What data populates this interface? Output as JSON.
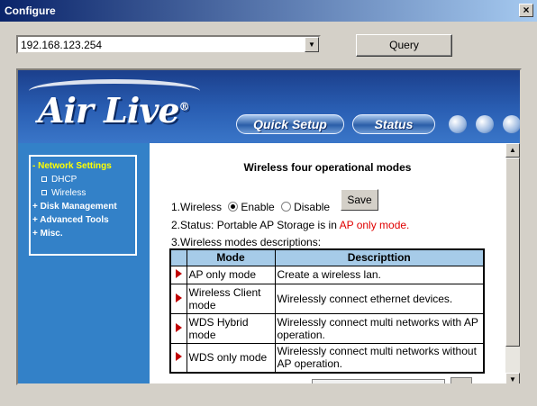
{
  "window": {
    "title": "Configure",
    "close_label": "×"
  },
  "toolbar": {
    "address_value": "192.168.123.254",
    "dropdown_glyph": "▼",
    "query_label": "Query"
  },
  "banner": {
    "logo_text": "Air Live",
    "logo_mark": "®",
    "quick_setup_label": "Quick Setup",
    "status_label": "Status"
  },
  "sidebar": {
    "items": [
      {
        "label": "- Network Settings"
      },
      {
        "label": "DHCP"
      },
      {
        "label": "Wireless"
      },
      {
        "label": "+ Disk Management"
      },
      {
        "label": "+ Advanced Tools"
      },
      {
        "label": "+ Misc."
      }
    ]
  },
  "content": {
    "heading": "Wireless four operational modes",
    "wireless_label": "1.Wireless",
    "enable_label": "Enable",
    "disable_label": "Disable",
    "save_label": "Save",
    "status_prefix": "2.Status: Portable AP Storage is in ",
    "status_value": "AP only mode.",
    "modes_label": "3.Wireless modes descriptions:",
    "table": {
      "headers": [
        "Mode",
        "Descripttion"
      ],
      "rows": [
        {
          "mode": "AP only mode",
          "desc": "Create a wireless lan."
        },
        {
          "mode": "Wireless Client mode",
          "desc": "Wirelessly connect ethernet devices."
        },
        {
          "mode": "WDS Hybrid mode",
          "desc": "Wirelessly connect multi networks with AP operation."
        },
        {
          "mode": "WDS only mode",
          "desc": "Wirelessly connect multi networks without AP operation."
        }
      ]
    }
  },
  "scrollbar": {
    "up_glyph": "▲",
    "down_glyph": "▼"
  },
  "colors": {
    "accent": "#3381c8",
    "status_red": "#e00000",
    "table_header": "#a6cbe8",
    "active_menu": "#ffff00"
  }
}
